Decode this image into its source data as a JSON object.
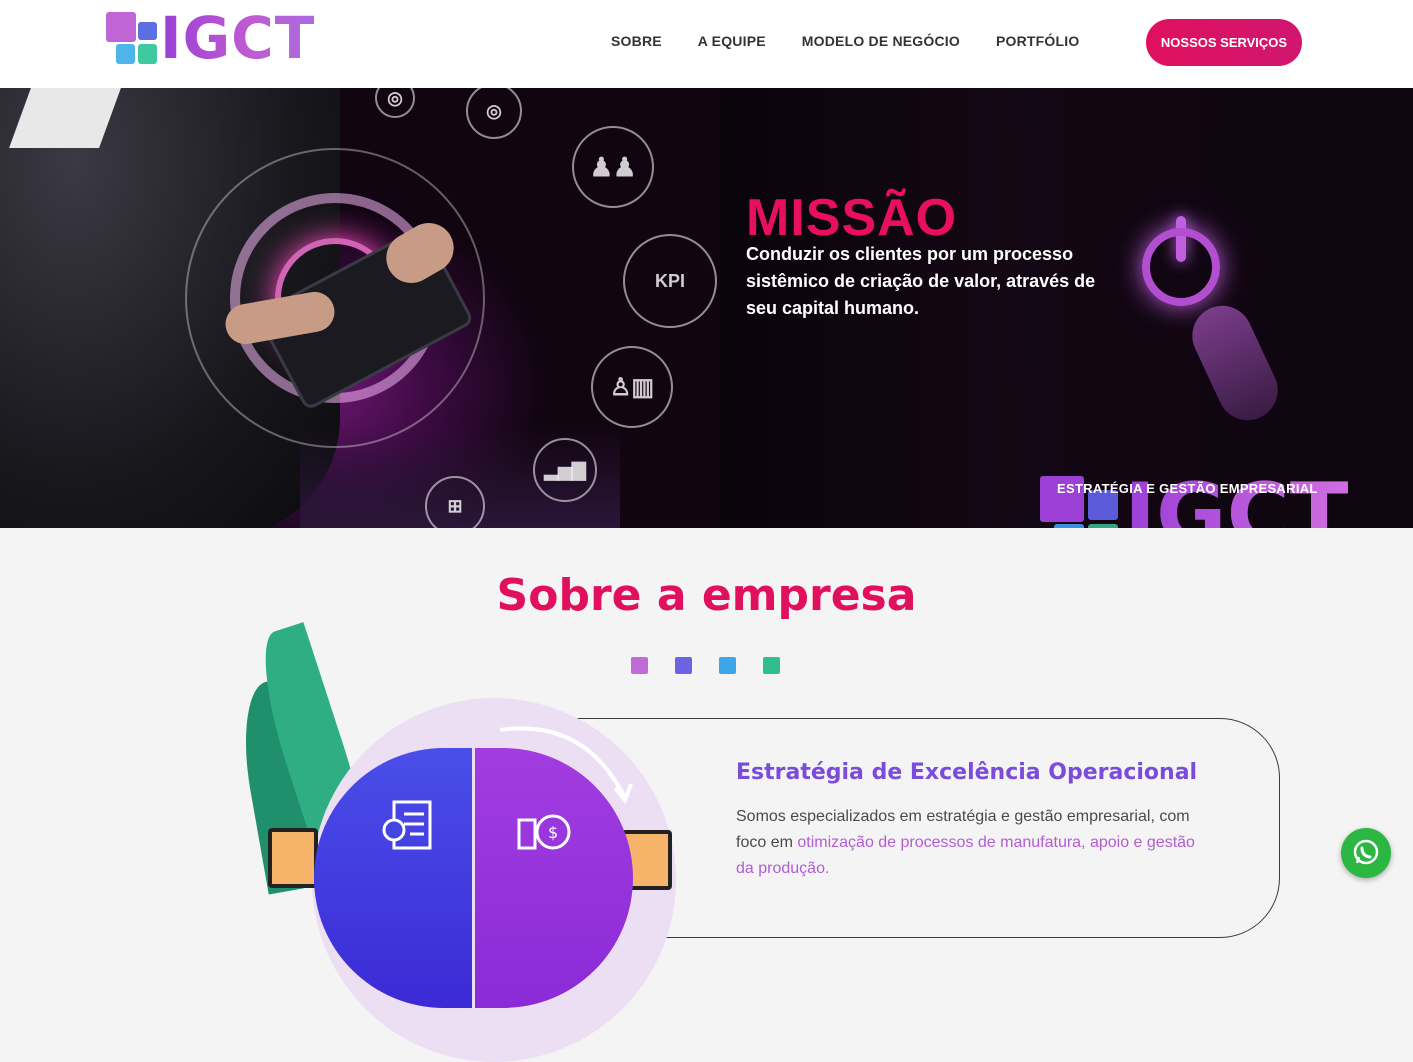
{
  "header": {
    "logo_text": "IGCT",
    "nav": [
      "SOBRE",
      "A EQUIPE",
      "MODELO DE NEGÓCIO",
      "PORTFÓLIO"
    ],
    "cta_label": "NOSSOS SERVIÇOS"
  },
  "hero": {
    "title": "MISSÃO",
    "text": "Conduzir os clientes por um processo sistêmico de criação de valor, através de seu capital humano.",
    "kpi_label": "KPI",
    "logo_text": "IGCT",
    "logo_subtitle": "ESTRATÉGIA E GESTÃO EMPRESARIAL"
  },
  "about": {
    "title": "Sobre a empresa",
    "dot_colors": [
      "#c06ad8",
      "#6c63e4",
      "#3ea6e8",
      "#2fbf8f"
    ],
    "card_title": "Estratégia de Excelência Operacional",
    "card_text_plain": "Somos especializados em estratégia e gestão empresarial, com foco em ",
    "card_text_highlight": "otimização de processos de manufatura, apoio e gestão da produção."
  },
  "colors": {
    "accent_pink": "#e0105e",
    "accent_purple": "#7b4bdc",
    "whatsapp_green": "#2bb741"
  }
}
